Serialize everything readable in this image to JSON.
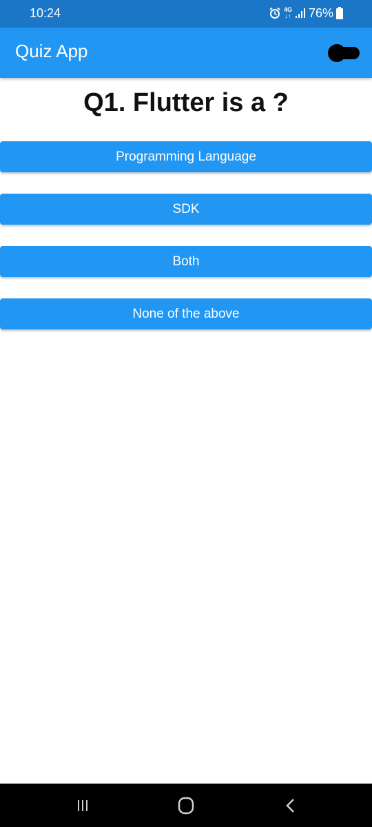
{
  "status_bar": {
    "time": "10:24",
    "network_top": "4G",
    "network_bottom": "↓↑",
    "battery_percent": "76%",
    "icons": [
      "alarm-icon",
      "network-icon",
      "signal-icon",
      "battery-icon"
    ],
    "background": "#1c76c8"
  },
  "app_bar": {
    "title": "Quiz App",
    "background": "#2196f3",
    "toggle_icon": "theme-toggle-icon"
  },
  "question": {
    "text": "Q1. Flutter is a ?"
  },
  "answers": [
    {
      "label": "Programming Language"
    },
    {
      "label": "SDK"
    },
    {
      "label": "Both"
    },
    {
      "label": "None of the above"
    }
  ],
  "nav_bar": {
    "icons": [
      "recent-apps-icon",
      "home-icon",
      "back-icon"
    ],
    "background": "#000000"
  }
}
